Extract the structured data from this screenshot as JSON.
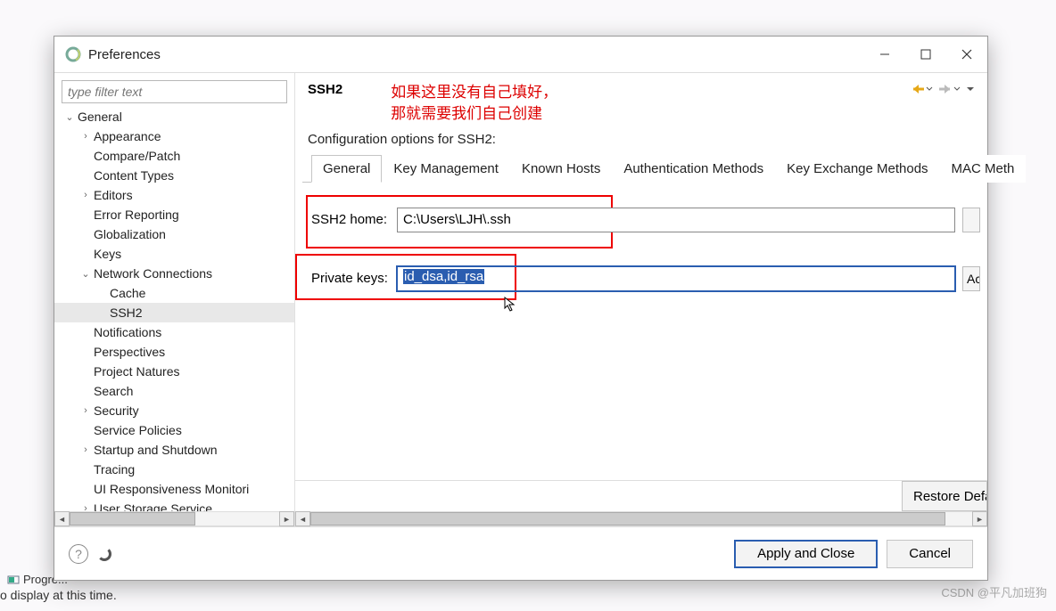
{
  "background": {
    "progress_label": "Progre...",
    "display_text": "o display at this time.",
    "watermark": "CSDN @平凡加班狗"
  },
  "dialog": {
    "title": "Preferences",
    "filter_placeholder": "type filter text",
    "header": {
      "title": "SSH2",
      "description": "Configuration options for SSH2:"
    },
    "annotation": {
      "line1": "如果这里没有自己填好，",
      "line2": "那就需要我们自己创建"
    },
    "tabs": [
      "General",
      "Key Management",
      "Known Hosts",
      "Authentication Methods",
      "Key Exchange Methods",
      "MAC Meth"
    ],
    "form": {
      "ssh2_home_label": "SSH2 home:",
      "ssh2_home_value": "C:\\Users\\LJH\\.ssh",
      "private_keys_label": "Private keys:",
      "private_keys_value": "id_dsa,id_rsa",
      "add_button": "Ac"
    },
    "restore_label": "Restore Defau",
    "footer": {
      "apply": "Apply and Close",
      "cancel": "Cancel"
    }
  },
  "tree": [
    {
      "label": "General",
      "depth": 0,
      "expand": "v"
    },
    {
      "label": "Appearance",
      "depth": 1,
      "expand": ">"
    },
    {
      "label": "Compare/Patch",
      "depth": 1,
      "expand": ""
    },
    {
      "label": "Content Types",
      "depth": 1,
      "expand": ""
    },
    {
      "label": "Editors",
      "depth": 1,
      "expand": ">"
    },
    {
      "label": "Error Reporting",
      "depth": 1,
      "expand": ""
    },
    {
      "label": "Globalization",
      "depth": 1,
      "expand": ""
    },
    {
      "label": "Keys",
      "depth": 1,
      "expand": ""
    },
    {
      "label": "Network Connections",
      "depth": 1,
      "expand": "v"
    },
    {
      "label": "Cache",
      "depth": 2,
      "expand": ""
    },
    {
      "label": "SSH2",
      "depth": 2,
      "expand": "",
      "selected": true
    },
    {
      "label": "Notifications",
      "depth": 1,
      "expand": ""
    },
    {
      "label": "Perspectives",
      "depth": 1,
      "expand": ""
    },
    {
      "label": "Project Natures",
      "depth": 1,
      "expand": ""
    },
    {
      "label": "Search",
      "depth": 1,
      "expand": ""
    },
    {
      "label": "Security",
      "depth": 1,
      "expand": ">"
    },
    {
      "label": "Service Policies",
      "depth": 1,
      "expand": ""
    },
    {
      "label": "Startup and Shutdown",
      "depth": 1,
      "expand": ">"
    },
    {
      "label": "Tracing",
      "depth": 1,
      "expand": ""
    },
    {
      "label": "UI Responsiveness Monitori",
      "depth": 1,
      "expand": ""
    },
    {
      "label": "User Storage Service",
      "depth": 1,
      "expand": ">"
    }
  ]
}
